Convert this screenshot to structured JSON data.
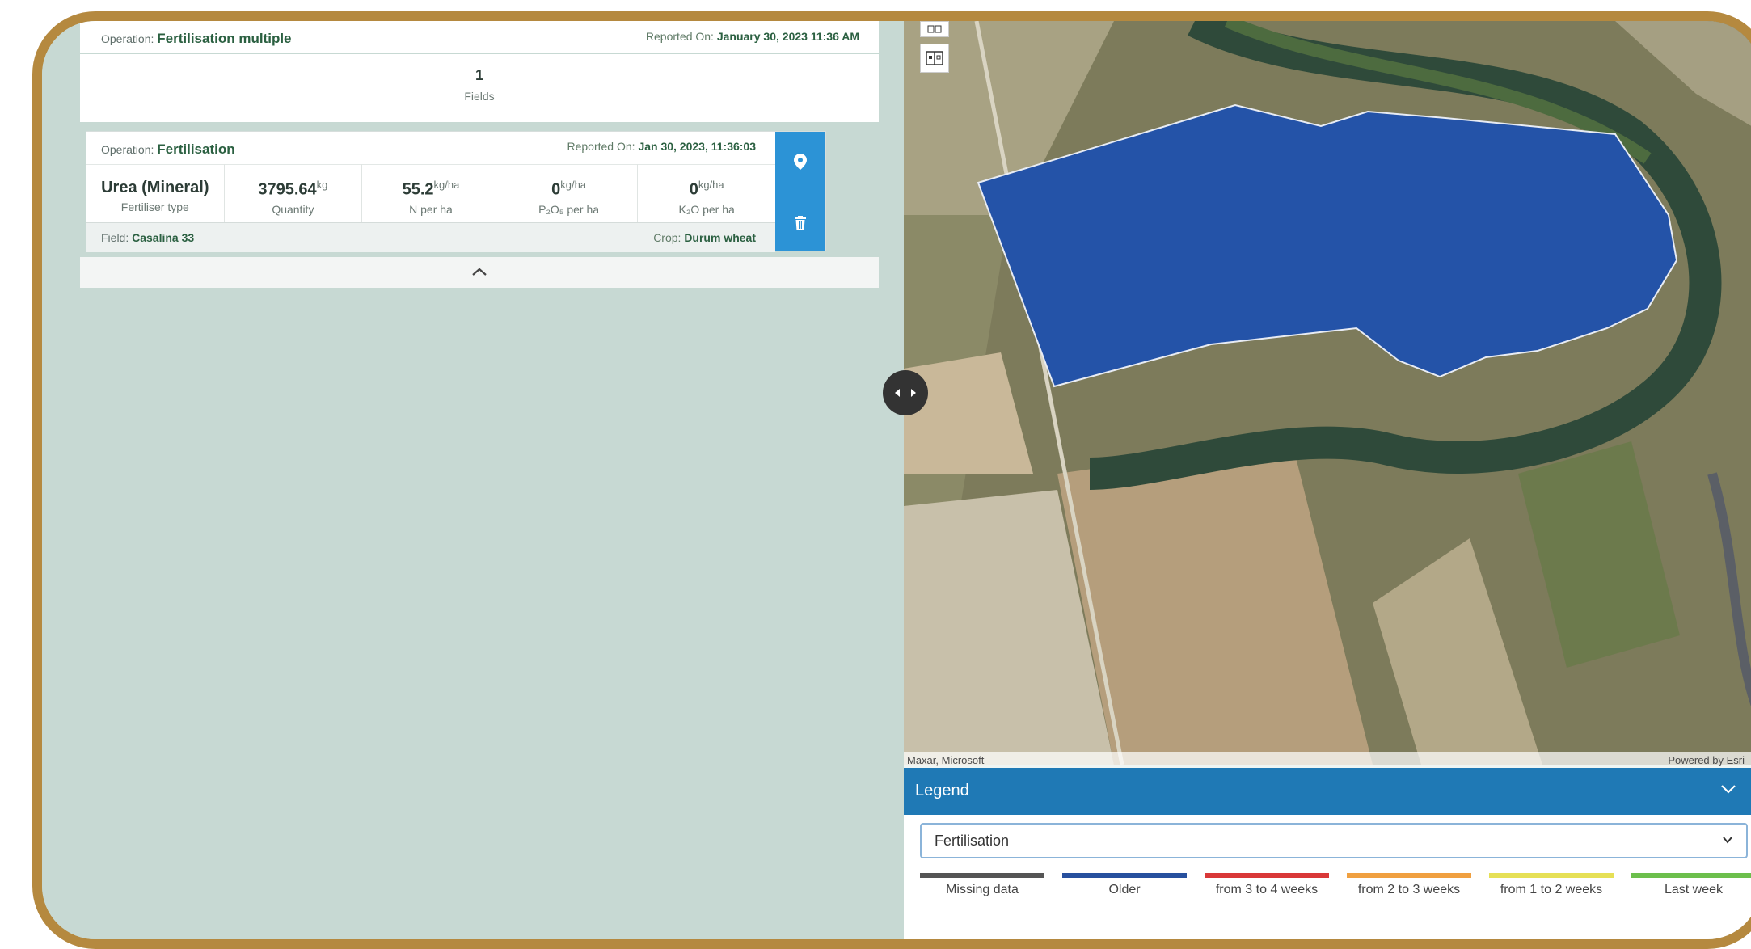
{
  "operation_header": {
    "label": "Operation:",
    "name": "Fertilisation multiple",
    "reported_label": "Reported On:",
    "reported_value": "January 30, 2023 11:36 AM"
  },
  "fields_summary": {
    "count": "1",
    "label": "Fields"
  },
  "sub_operation": {
    "label": "Operation:",
    "name": "Fertilisation",
    "reported_label": "Reported On:",
    "reported_value": "Jan 30, 2023, 11:36:03",
    "stats": [
      {
        "value": "Urea (Mineral)",
        "unit": "",
        "label": "Fertiliser type"
      },
      {
        "value": "3795.64",
        "unit": "kg",
        "label": "Quantity"
      },
      {
        "value": "55.2",
        "unit": "kg/ha",
        "label": "N per ha"
      },
      {
        "value": "0",
        "unit": "kg/ha",
        "label": "P₂O₅ per ha"
      },
      {
        "value": "0",
        "unit": "kg/ha",
        "label": "K₂O per ha"
      }
    ],
    "field_label": "Field:",
    "field_value": "Casalina 33",
    "crop_label": "Crop:",
    "crop_value": "Durum wheat"
  },
  "map": {
    "attribution_left": "Maxar, Microsoft",
    "attribution_right": "Powered by Esri",
    "polygon_color": "#2453a8"
  },
  "legend": {
    "title": "Legend",
    "selected": "Fertilisation",
    "items": [
      {
        "label": "Missing data",
        "color": "#555555"
      },
      {
        "label": "Older",
        "color": "#27509e"
      },
      {
        "label": "from 3 to 4 weeks",
        "color": "#d93838"
      },
      {
        "label": "from 2 to 3 weeks",
        "color": "#f0a040"
      },
      {
        "label": "from 1 to 2 weeks",
        "color": "#e6e056"
      },
      {
        "label": "Last week",
        "color": "#6cbf4c"
      }
    ]
  },
  "colors": {
    "accent": "#2c93d6",
    "legend_bar": "#1f79b5",
    "frame": "#b5893f",
    "panel_bg": "#c7d9d3"
  }
}
